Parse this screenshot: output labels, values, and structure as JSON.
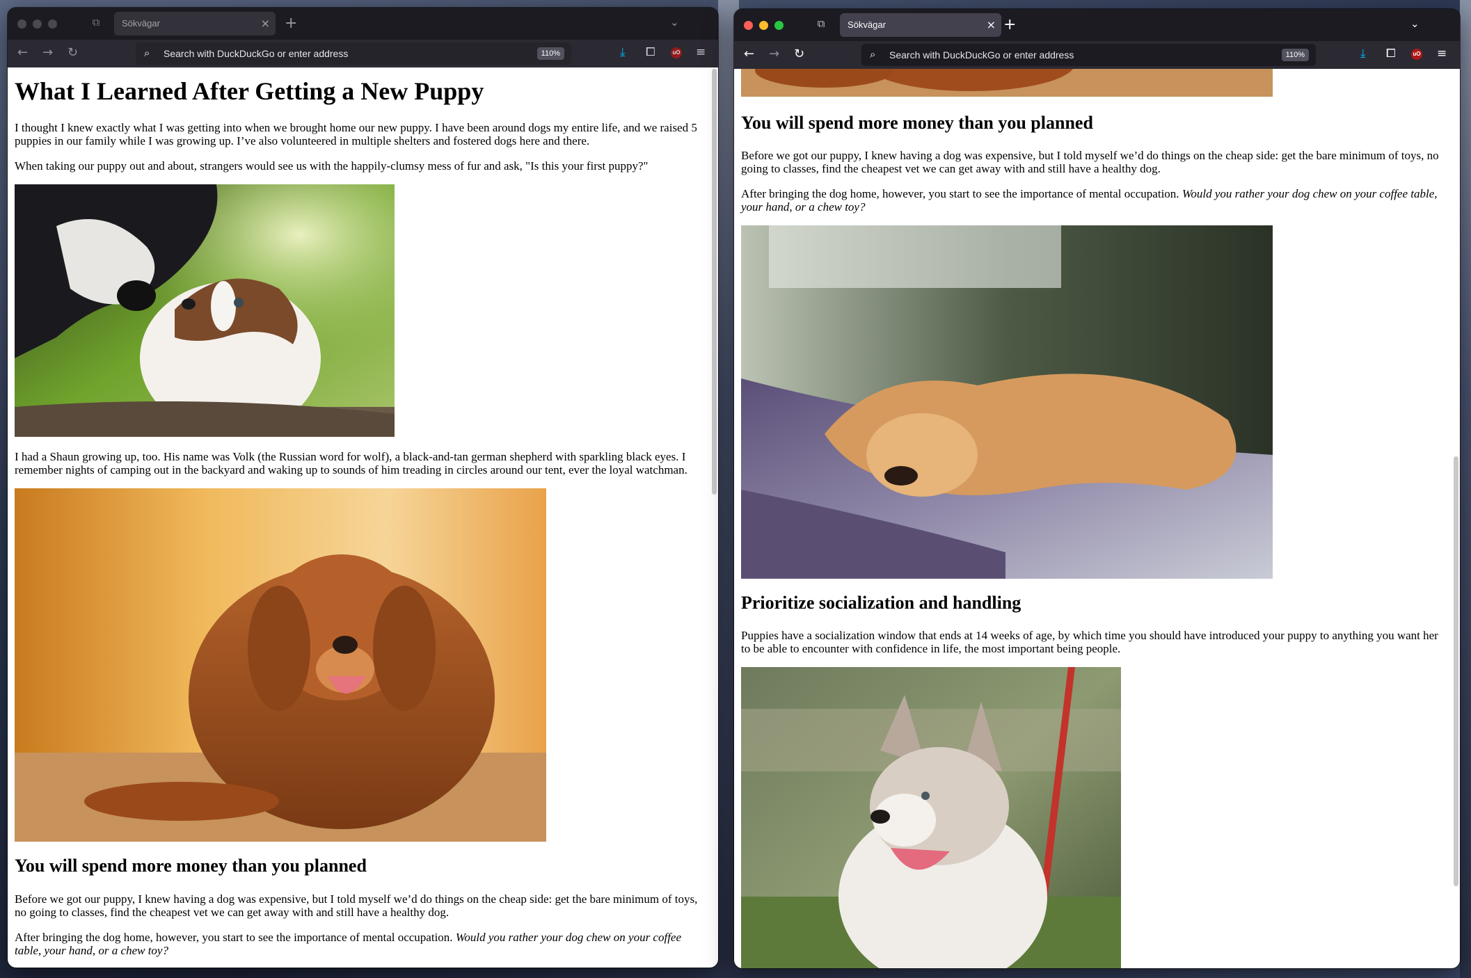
{
  "left_window": {
    "tab": {
      "title": "Sökvägar"
    },
    "address_bar": {
      "placeholder": "Search with DuckDuckGo or enter address",
      "zoom": "110%"
    },
    "extension": {
      "label": "uO"
    },
    "article": {
      "title": "What I Learned After Getting a New Puppy",
      "p1": "I thought I knew exactly what I was getting into when we brought home our new puppy. I have been around dogs my entire life, and we raised 5 puppies in our family while I was growing up. I’ve also volunteered in multiple shelters and fostered dogs here and there.",
      "p2": "When taking our puppy out and about, strangers would see us with the happily-clumsy mess of fur and ask, \"Is this your first puppy?\"",
      "p3": "I had a Shaun growing up, too. His name was Volk (the Russian word for wolf), a black-and-tan german shepherd with sparkling black eyes. I remember nights of camping out in the backyard and waking up to sounds of him treading in circles around our tent, ever the loyal watchman.",
      "h2_money": "You will spend more money than you planned",
      "p_money1": "Before we got our puppy, I knew having a dog was expensive, but I told myself we’d do things on the cheap side: get the bare minimum of toys, no going to classes, find the cheapest vet we can get away with and still have a healthy dog.",
      "p_money2_start": "After bringing the dog home, however, you start to see the importance of mental occupation. ",
      "p_money2_italic": "Would you rather your dog chew on your coffee table, your hand, or a chew toy?"
    }
  },
  "right_window": {
    "tab": {
      "title": "Sökvägar"
    },
    "address_bar": {
      "placeholder": "Search with DuckDuckGo or enter address",
      "zoom": "110%"
    },
    "extension": {
      "label": "uO"
    },
    "article": {
      "h2_money": "You will spend more money than you planned",
      "p_money1": "Before we got our puppy, I knew having a dog was expensive, but I told myself we’d do things on the cheap side: get the bare minimum of toys, no going to classes, find the cheapest vet we can get away with and still have a healthy dog.",
      "p_money2_start": "After bringing the dog home, however, you start to see the importance of mental occupation. ",
      "p_money2_italic": "Would you rather your dog chew on your coffee table, your hand, or a chew toy?",
      "h2_social": "Prioritize socialization and handling",
      "p_social": "Puppies have a socialization window that ends at 14 weeks of age, by which time you should have introduced your puppy to anything you want her to be able to encounter with confidence in life, the most important being people."
    }
  }
}
